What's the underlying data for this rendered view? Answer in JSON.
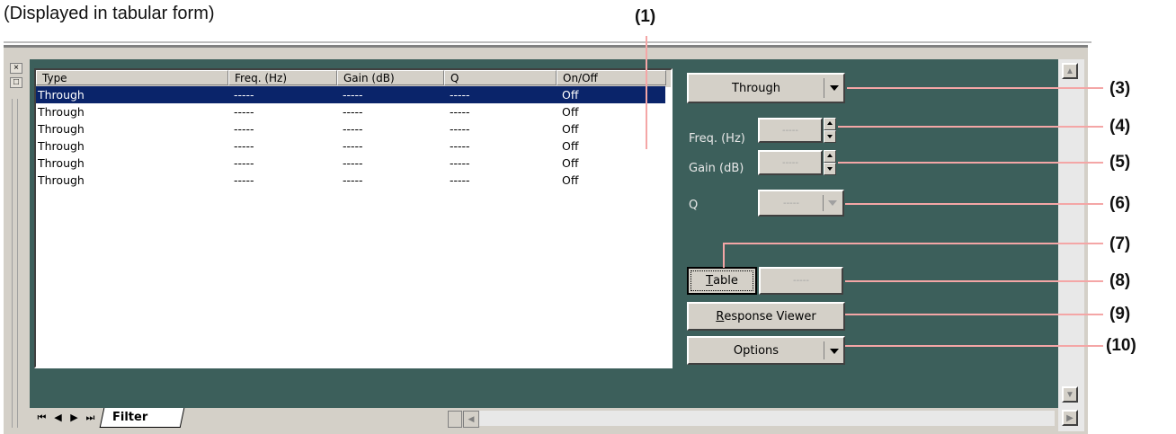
{
  "caption": "(Displayed in tabular form)",
  "callouts": {
    "c1": "(1)",
    "c3": "(3)",
    "c4": "(4)",
    "c5": "(5)",
    "c6": "(6)",
    "c7": "(7)",
    "c8": "(8)",
    "c9": "(9)",
    "c10": "(10)"
  },
  "window": {
    "close_glyph": "×",
    "restore_glyph": "□"
  },
  "table": {
    "columns": [
      "Type",
      "Freq. (Hz)",
      "Gain (dB)",
      "Q",
      "On/Off"
    ],
    "rows": [
      {
        "type": "Through",
        "freq": "-----",
        "gain": "-----",
        "q": "-----",
        "onoff": "Off"
      },
      {
        "type": "Through",
        "freq": "-----",
        "gain": "-----",
        "q": "-----",
        "onoff": "Off"
      },
      {
        "type": "Through",
        "freq": "-----",
        "gain": "-----",
        "q": "-----",
        "onoff": "Off"
      },
      {
        "type": "Through",
        "freq": "-----",
        "gain": "-----",
        "q": "-----",
        "onoff": "Off"
      },
      {
        "type": "Through",
        "freq": "-----",
        "gain": "-----",
        "q": "-----",
        "onoff": "Off"
      },
      {
        "type": "Through",
        "freq": "-----",
        "gain": "-----",
        "q": "-----",
        "onoff": "Off"
      }
    ],
    "selected_row": 0
  },
  "controls": {
    "type_select": "Through",
    "freq_label": "Freq. (Hz)",
    "freq_value": "-----",
    "gain_label": "Gain (dB)",
    "gain_value": "-----",
    "q_label": "Q",
    "q_value": "-----",
    "table_button": "Table",
    "table_button_mnemonic": "T",
    "table_button_rest": "able",
    "table_value": "-----",
    "response_viewer_mnemonic": "R",
    "response_viewer_rest": "esponse Viewer",
    "options_button": "Options"
  },
  "tabs": {
    "first_glyph": "⏮",
    "prev_glyph": "◀",
    "next_glyph": "▶",
    "last_glyph": "⏭",
    "active_tab": "Filter"
  },
  "colors": {
    "panel_bg": "#3c5f5b",
    "selection": "#0a246a",
    "callout_line": "#f4a6a6"
  }
}
